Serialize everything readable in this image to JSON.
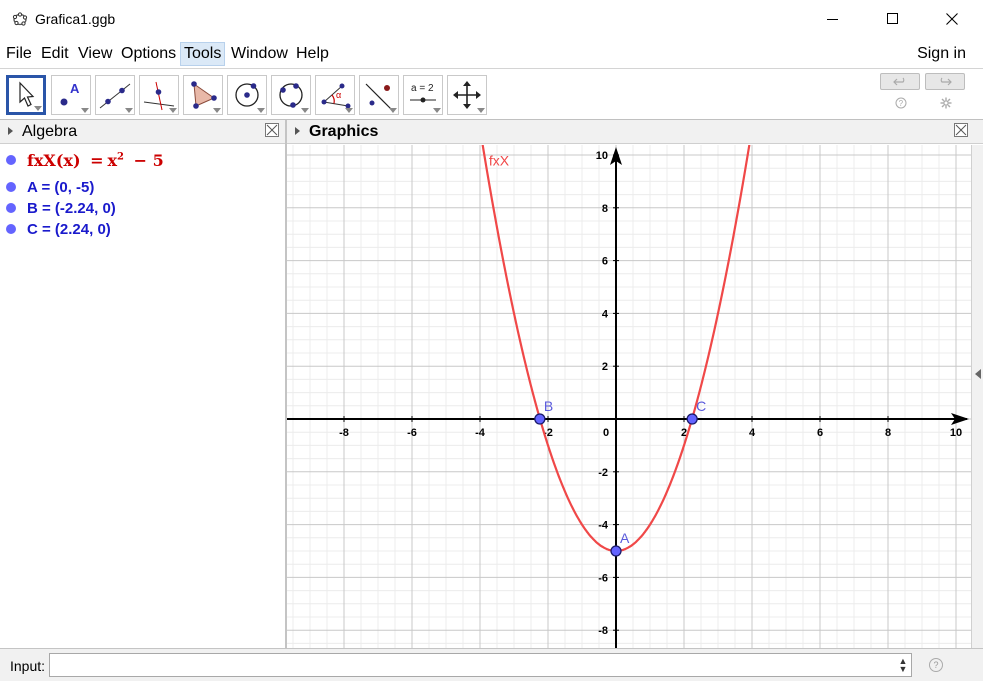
{
  "window": {
    "title": "Grafica1.ggb"
  },
  "menu": {
    "items": [
      {
        "label": "File"
      },
      {
        "label": "Edit"
      },
      {
        "label": "View"
      },
      {
        "label": "Options"
      },
      {
        "label": "Tools",
        "active": true
      },
      {
        "label": "Window"
      },
      {
        "label": "Help"
      }
    ],
    "sign_in": "Sign in"
  },
  "toolbar": {
    "tools": [
      {
        "name": "move-tool-icon",
        "selected": true
      },
      {
        "name": "point-tool-icon"
      },
      {
        "name": "line-tool-icon"
      },
      {
        "name": "perpendicular-line-tool-icon"
      },
      {
        "name": "polygon-tool-icon"
      },
      {
        "name": "circle-tool-icon"
      },
      {
        "name": "circle-through-points-tool-icon"
      },
      {
        "name": "angle-tool-icon"
      },
      {
        "name": "reflect-tool-icon"
      },
      {
        "name": "slider-tool-icon",
        "label": "a = 2"
      },
      {
        "name": "move-graphics-view-tool-icon"
      }
    ]
  },
  "algebra": {
    "title": "Algebra",
    "function": {
      "name": "fxX(x)",
      "eq": "=",
      "base": "x",
      "exponent": "2",
      "rest": "− 5",
      "color": "#cc0000"
    },
    "points": [
      {
        "label": "A = (0, -5)",
        "color": "#1a1acc"
      },
      {
        "label": "B = (-2.24, 0)",
        "color": "#1a1acc"
      },
      {
        "label": "C = (2.24, 0)",
        "color": "#1a1acc"
      }
    ],
    "dot_color": "#6464ff"
  },
  "graphics": {
    "title": "Graphics",
    "curve_label": "fxX",
    "curve_color": "#f04848",
    "point_fill": "#6464ff",
    "x_ticks": [
      "-8",
      "-6",
      "-4",
      "-2",
      "0",
      "2",
      "4",
      "6",
      "8",
      "10"
    ],
    "y_ticks": [
      "10",
      "8",
      "6",
      "4",
      "2",
      "-2",
      "-4",
      "-6",
      "-8"
    ],
    "points": [
      {
        "name": "A",
        "x": 0,
        "y": -5
      },
      {
        "name": "B",
        "x": -2.24,
        "y": 0
      },
      {
        "name": "C",
        "x": 2.24,
        "y": 0
      }
    ],
    "function": {
      "expr": "x^2 - 5",
      "a": 1,
      "c": -5
    }
  },
  "input": {
    "label": "Input:",
    "value": ""
  }
}
